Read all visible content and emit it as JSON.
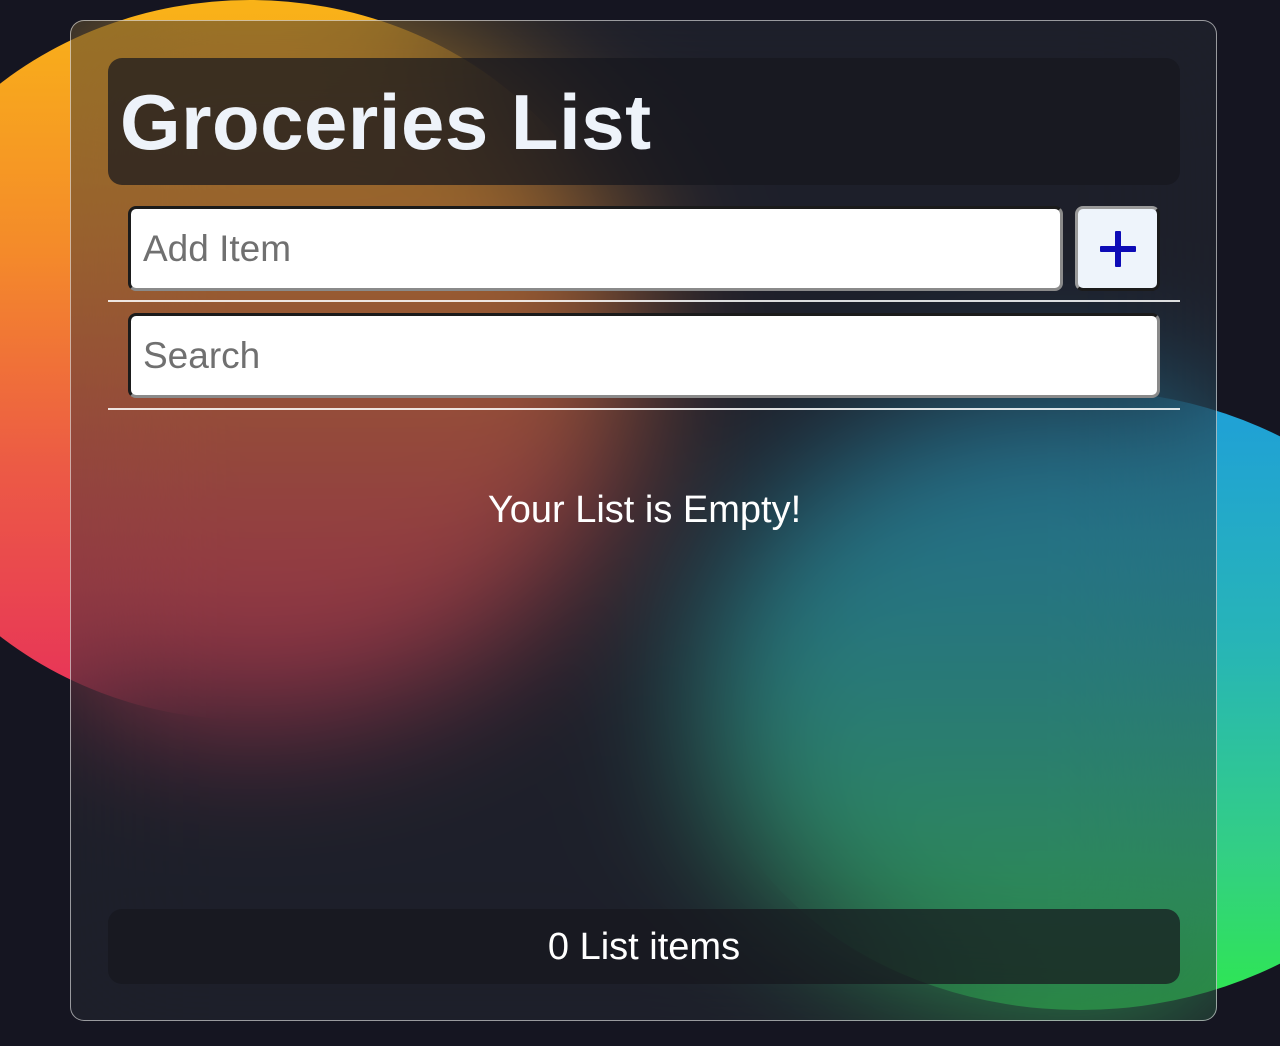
{
  "colors": {
    "page_background": "#151521",
    "add_button_icon": "#0d0bb6",
    "add_button_bg": "#eef4fb"
  },
  "header": {
    "title": "Groceries List"
  },
  "add_item": {
    "placeholder": "Add Item",
    "value": "",
    "button_icon": "plus-icon"
  },
  "search": {
    "placeholder": "Search",
    "value": ""
  },
  "list": {
    "items": [],
    "empty_message": "Your List is Empty!"
  },
  "footer": {
    "count_text": "0 List items"
  }
}
